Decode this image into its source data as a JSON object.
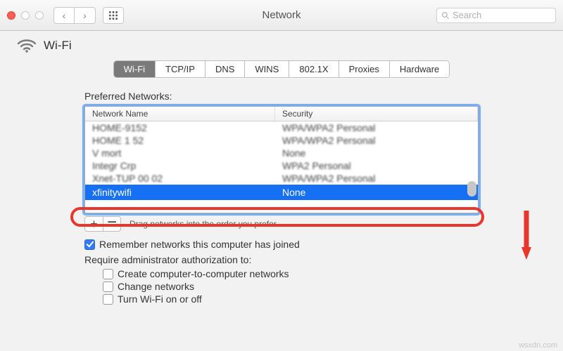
{
  "window": {
    "title": "Network",
    "search_placeholder": "Search"
  },
  "page": {
    "icon": "wifi-icon",
    "heading": "Wi-Fi"
  },
  "tabs": [
    {
      "label": "Wi-Fi",
      "active": true
    },
    {
      "label": "TCP/IP"
    },
    {
      "label": "DNS"
    },
    {
      "label": "WINS"
    },
    {
      "label": "802.1X"
    },
    {
      "label": "Proxies"
    },
    {
      "label": "Hardware"
    }
  ],
  "preferred_networks": {
    "label": "Preferred Networks:",
    "columns": {
      "name": "Network Name",
      "security": "Security"
    },
    "rows": [
      {
        "name": "HOME-9152",
        "security": "WPA/WPA2 Personal"
      },
      {
        "name": "HOME 1 52",
        "security": "WPA/WPA2 Personal"
      },
      {
        "name": "V    mort",
        "security": "None"
      },
      {
        "name": "Integr  Crp",
        "security": "WPA2 Personal"
      },
      {
        "name": "Xnet-TUP 00 02",
        "security": "WPA/WPA2 Personal"
      },
      {
        "name": "xfinitywifi",
        "security": "None",
        "selected": true
      }
    ],
    "add_label": "+",
    "remove_label": "−",
    "hint": "Drag networks into the order you prefer."
  },
  "options": {
    "remember": {
      "checked": true,
      "label": "Remember networks this computer has joined"
    },
    "require_admin_label": "Require administrator authorization to:",
    "admin_opts": [
      {
        "label": "Create computer-to-computer networks"
      },
      {
        "label": "Change networks"
      },
      {
        "label": "Turn Wi-Fi on or off"
      }
    ]
  },
  "watermark": "wsxdn.com"
}
